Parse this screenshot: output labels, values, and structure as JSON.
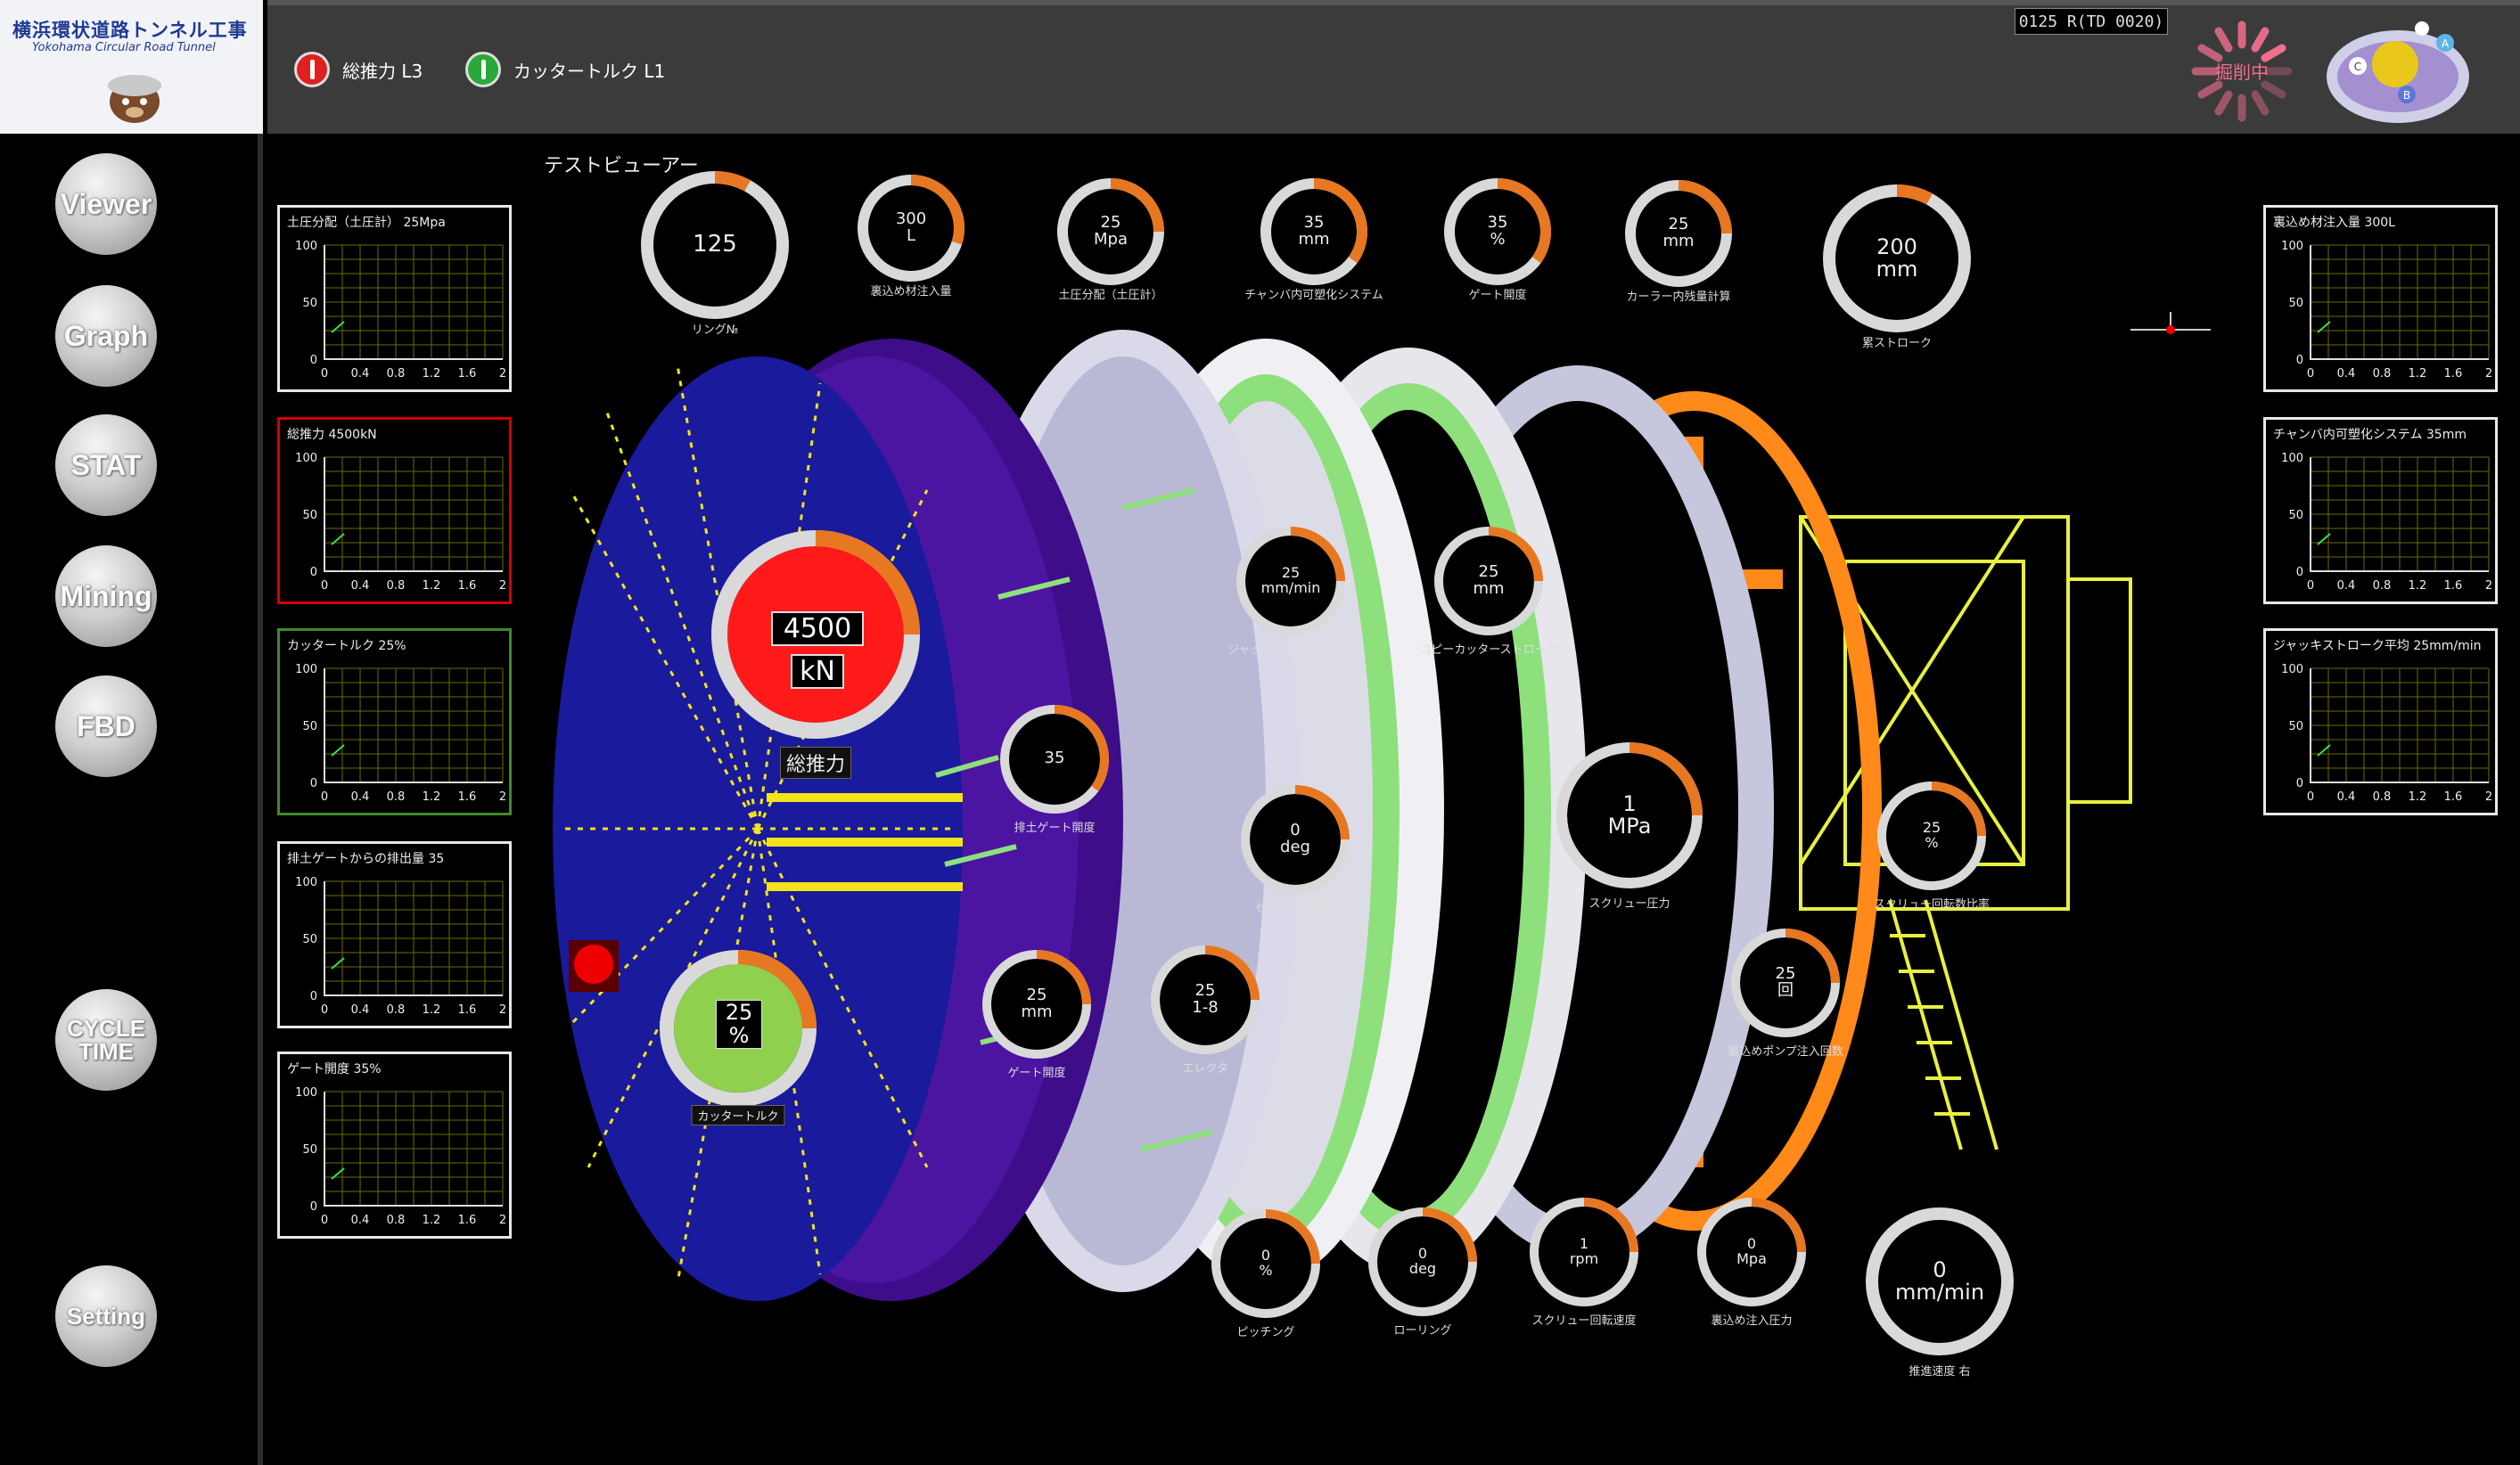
{
  "app": {
    "logo_title": "横浜環状道路トンネル工事",
    "logo_subtitle": "Yokohama Circular Road Tunnel",
    "ring_counter": "0125 R(TD 0020)",
    "status_badge": "掘削中"
  },
  "alarms": [
    {
      "label": "総推力 L3",
      "color": "#e02020"
    },
    {
      "label": "カッタートルク L1",
      "color": "#2aa838"
    }
  ],
  "sidebar": [
    {
      "label": "Viewer"
    },
    {
      "label": "Graph"
    },
    {
      "label": "STAT"
    },
    {
      "label": "Mining"
    },
    {
      "label": "FBD"
    },
    {
      "label": "CYCLE TIME"
    },
    {
      "label": "Setting"
    }
  ],
  "view_title": "テストビューアー",
  "left_panels": [
    {
      "title": "土圧分配（土圧計） 25Mpa",
      "state": "normal"
    },
    {
      "title": "総推力 4500kN",
      "state": "alarm"
    },
    {
      "title": "カッタートルク 25%",
      "state": "ok"
    },
    {
      "title": "排土ゲートからの排出量 35",
      "state": "normal"
    },
    {
      "title": "ゲート開度 35%",
      "state": "normal"
    }
  ],
  "right_panels": [
    {
      "title": "裏込め材注入量 300L"
    },
    {
      "title": "チャンバ内可塑化システム 35mm"
    },
    {
      "title": "ジャッキストローク平均 25mm/min"
    }
  ],
  "graph_axis": {
    "y_ticks": [
      "100",
      "50",
      "0"
    ],
    "x_ticks": [
      "0",
      "0.4",
      "0.8",
      "1.2",
      "1.6",
      "2"
    ]
  },
  "top_gauges": [
    {
      "value": "125",
      "unit": "",
      "label": "リング№",
      "fill": 0.08
    },
    {
      "value": "300",
      "unit": "L",
      "label": "裏込め材注入量",
      "fill": 0.3
    },
    {
      "value": "25",
      "unit": "Mpa",
      "label": "土圧分配（土圧計）",
      "fill": 0.25
    },
    {
      "value": "35",
      "unit": "mm",
      "label": "チャンバ内可塑化システム",
      "fill": 0.35
    },
    {
      "value": "35",
      "unit": "%",
      "label": "ゲート開度",
      "fill": 0.35
    },
    {
      "value": "25",
      "unit": "mm",
      "label": "カーラー内残量計算",
      "fill": 0.25
    },
    {
      "value": "200",
      "unit": "mm",
      "label": "累ストローク",
      "fill": 0.08
    }
  ],
  "main_gauges": {
    "thrust": {
      "value": "4500",
      "unit": "kN",
      "label": "総推力",
      "fill": 0.25
    },
    "torque": {
      "value": "25",
      "unit": "%",
      "label": "カッタートルク",
      "fill": 0.25
    }
  },
  "machine_gauges": [
    {
      "value": "35",
      "unit": "",
      "label": "排土ゲート開度",
      "fill": 0.35
    },
    {
      "value": "25",
      "unit": "mm",
      "label": "ゲート開度",
      "fill": 0.25
    },
    {
      "value": "25",
      "unit": "mm/min",
      "label": "ジャッキストローク平均",
      "fill": 0.25
    },
    {
      "value": "0",
      "unit": "deg",
      "label": "セグメント角度",
      "fill": 0.25
    },
    {
      "value": "25",
      "unit": "1-8",
      "label": "エレクタ",
      "fill": 0.25
    },
    {
      "value": "25",
      "unit": "mm",
      "label": "コピーカッターストローク",
      "fill": 0.25
    },
    {
      "value": "1",
      "unit": "MPa",
      "label": "スクリュー圧力",
      "fill": 0.25
    },
    {
      "value": "25",
      "unit": "%",
      "label": "スクリュー回転数比率",
      "fill": 0.25
    },
    {
      "value": "25",
      "unit": "回",
      "label": "裏込めポンプ注入回数",
      "fill": 0.25
    },
    {
      "value": "0",
      "unit": "%",
      "label": "ピッチング",
      "fill": 0.25
    },
    {
      "value": "0",
      "unit": "deg",
      "label": "ローリング",
      "fill": 0.25
    },
    {
      "value": "1",
      "unit": "rpm",
      "label": "スクリュー回転速度",
      "fill": 0.25
    },
    {
      "value": "0",
      "unit": "Mpa",
      "label": "裏込め注入圧力",
      "fill": 0.25
    },
    {
      "value": "0",
      "unit": "mm/min",
      "label": "推進速度 右",
      "fill": 0.0
    }
  ],
  "colors": {
    "gauge_track": "#d9d9d9",
    "gauge_fill": "#e87722",
    "thrust_alarm": "#ff1a1a",
    "torque_ok": "#8fd14f",
    "cutter_blue": "#1a1a9c",
    "cutter_bits": "#f2e31b"
  }
}
